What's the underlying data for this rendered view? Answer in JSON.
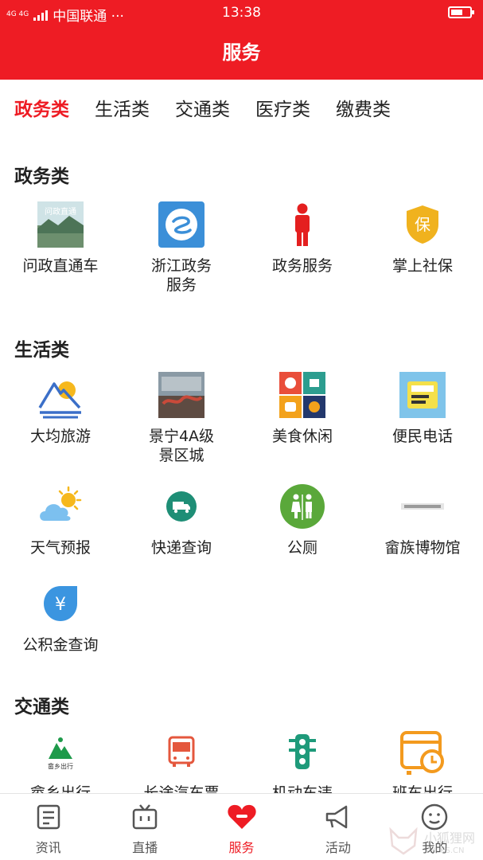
{
  "status_bar": {
    "network": "4G 4G",
    "carrier": "中国联通 ···",
    "time": "13:38"
  },
  "header": {
    "title": "服务"
  },
  "tabs": [
    {
      "label": "政务类",
      "active": true
    },
    {
      "label": "生活类",
      "active": false
    },
    {
      "label": "交通类",
      "active": false
    },
    {
      "label": "医疗类",
      "active": false
    },
    {
      "label": "缴费类",
      "active": false
    }
  ],
  "sections": {
    "gov": {
      "title": "政务类",
      "items": [
        {
          "label": "问政直通车",
          "icon": "wenzheng-photo-icon",
          "banner": "问政直通"
        },
        {
          "label": "浙江政务服务",
          "icon": "zhejiang-gov-icon"
        },
        {
          "label": "政务服务",
          "icon": "person-icon"
        },
        {
          "label": "掌上社保",
          "icon": "shield-icon",
          "badge": "保"
        }
      ]
    },
    "life": {
      "title": "生活类",
      "items": [
        {
          "label": "大均旅游",
          "icon": "mountain-sun-icon"
        },
        {
          "label": "景宁4A级景区城",
          "icon": "scenic-photo-icon"
        },
        {
          "label": "美食休闲",
          "icon": "food-collage-icon"
        },
        {
          "label": "便民电话",
          "icon": "phone-book-icon"
        },
        {
          "label": "天气预报",
          "icon": "weather-icon"
        },
        {
          "label": "快递查询",
          "icon": "delivery-truck-icon"
        },
        {
          "label": "公厕",
          "icon": "toilet-icon"
        },
        {
          "label": "畲族博物馆",
          "icon": "museum-icon"
        },
        {
          "label": "公积金查询",
          "icon": "yuan-drop-icon",
          "symbol": "¥"
        }
      ]
    },
    "traffic": {
      "title": "交通类",
      "items": [
        {
          "label": "畲乡出行",
          "icon": "sheshang-logo-icon",
          "caption": "畲乡出行"
        },
        {
          "label": "长途汽车票",
          "icon": "bus-icon"
        },
        {
          "label": "机动车违",
          "icon": "traffic-light-icon"
        },
        {
          "label": "班车出行",
          "icon": "shuttle-clock-icon"
        }
      ]
    }
  },
  "bottom_nav": [
    {
      "label": "资讯",
      "icon": "news-icon",
      "active": false
    },
    {
      "label": "直播",
      "icon": "tv-icon",
      "active": false
    },
    {
      "label": "服务",
      "icon": "heart-icon",
      "active": true
    },
    {
      "label": "活动",
      "icon": "megaphone-icon",
      "active": false
    },
    {
      "label": "我的",
      "icon": "face-icon",
      "active": false
    }
  ],
  "watermark": {
    "text": "小狐狸网",
    "sub": "XHLKS.CN"
  },
  "colors": {
    "brand": "#ee1c24",
    "text": "#222222",
    "teal": "#2a9d8f",
    "orange": "#f39a1e"
  }
}
